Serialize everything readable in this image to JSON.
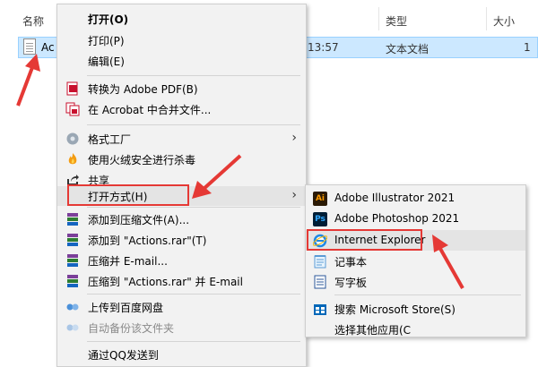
{
  "explorer": {
    "col_name": "名称",
    "col_type": "类型",
    "col_size": "大小",
    "file": {
      "name": "Ac",
      "date": "13:57",
      "type": "文本文档",
      "size": "1"
    }
  },
  "context_menu": {
    "items": [
      {
        "label": "打开(O)",
        "icon": "open"
      },
      {
        "label": "打印(P)",
        "icon": "none"
      },
      {
        "label": "编辑(E)",
        "icon": "none"
      },
      {
        "label": "转换为 Adobe PDF(B)",
        "icon": "adobe-pdf-icon"
      },
      {
        "label": "在 Acrobat 中合并文件...",
        "icon": "acrobat-combine-icon"
      },
      {
        "label": "格式工厂",
        "icon": "format-factory-icon"
      },
      {
        "label": "使用火绒安全进行杀毒",
        "icon": "huorong-icon"
      },
      {
        "label": "共享",
        "icon": "share-icon"
      },
      {
        "label": "打开方式(H)",
        "icon": "none"
      },
      {
        "label": "添加到压缩文件(A)...",
        "icon": "winrar-icon"
      },
      {
        "label": "添加到 \"Actions.rar\"(T)",
        "icon": "winrar-icon"
      },
      {
        "label": "压缩并 E-mail...",
        "icon": "winrar-icon"
      },
      {
        "label": "压缩到 \"Actions.rar\" 并 E-mail",
        "icon": "winrar-icon"
      },
      {
        "label": "上传到百度网盘",
        "icon": "baidu-netdisk-icon"
      },
      {
        "label": "自动备份该文件夹",
        "icon": "baidu-netdisk-icon"
      },
      {
        "label": "通过QQ发送到",
        "icon": "none"
      }
    ]
  },
  "submenu": {
    "items": [
      {
        "label": "Adobe Illustrator 2021",
        "icon": "illustrator-icon",
        "icon_text": "Ai"
      },
      {
        "label": "Adobe Photoshop 2021",
        "icon": "photoshop-icon",
        "icon_text": "Ps"
      },
      {
        "label": "Internet Explorer",
        "icon": "internet-explorer-icon",
        "icon_text": "e"
      },
      {
        "label": "记事本",
        "icon": "notepad-icon"
      },
      {
        "label": "写字板",
        "icon": "wordpad-icon"
      },
      {
        "label": "搜索 Microsoft Store(S)",
        "icon": "store-icon"
      },
      {
        "label": "选择其他应用(C",
        "icon": "none"
      }
    ]
  },
  "colors": {
    "menu_bg": "#f2f2f2",
    "highlight_box": "#e53935",
    "selection": "#cce8ff"
  }
}
